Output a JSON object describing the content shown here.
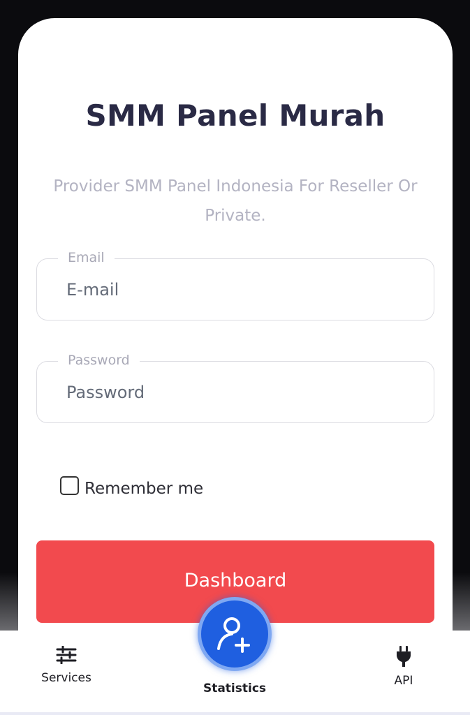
{
  "header": {
    "title": "SMM Panel Murah",
    "subtitle": "Provider SMM Panel Indonesia For Reseller Or Private."
  },
  "login_form": {
    "email": {
      "label": "Email",
      "placeholder": "E-mail",
      "value": ""
    },
    "password": {
      "label": "Password",
      "placeholder": "Password",
      "value": ""
    },
    "remember": {
      "label": "Remember me",
      "checked": false
    },
    "submit_label": "Dashboard"
  },
  "bottom_nav": {
    "items": [
      {
        "label": "Services",
        "icon": "sliders-icon"
      },
      {
        "label": "Statistics",
        "icon": "user-add-icon",
        "active": true
      },
      {
        "label": "API",
        "icon": "plug-icon"
      }
    ]
  },
  "colors": {
    "accent_button": "#f24a4e",
    "fab": "#1f5fe0",
    "title_text": "#2a2a45",
    "muted_text": "#b3b3c2"
  }
}
